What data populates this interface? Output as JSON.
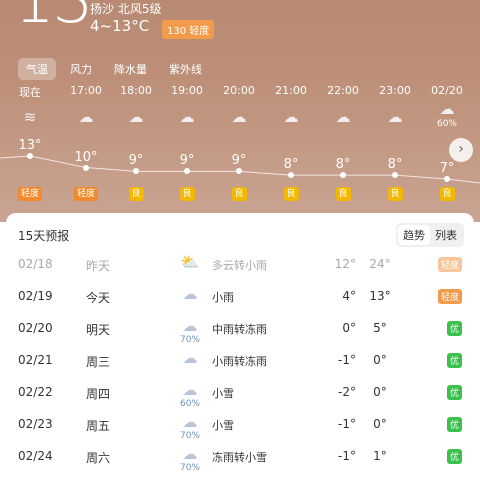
{
  "current": {
    "temp": "13°",
    "location_wind": "扬沙  北风5级",
    "range": "4~13°C",
    "aqi_label": "130 轻度"
  },
  "tabs": [
    {
      "label": "气温",
      "active": true
    },
    {
      "label": "风力",
      "active": false
    },
    {
      "label": "降水量",
      "active": false
    },
    {
      "label": "紫外线",
      "active": false
    }
  ],
  "hourly": [
    {
      "time": "现在",
      "icon": "sand-dust-icon",
      "temp": "13°",
      "aqi": "轻度",
      "aqi_color": "#f08a2c",
      "precip": ""
    },
    {
      "time": "17:00",
      "icon": "cloud-icon",
      "temp": "10°",
      "aqi": "轻度",
      "aqi_color": "#f08a2c",
      "precip": ""
    },
    {
      "time": "18:00",
      "icon": "cloud-icon",
      "temp": "9°",
      "aqi": "良",
      "aqi_color": "#f5b800",
      "precip": ""
    },
    {
      "time": "19:00",
      "icon": "cloud-icon",
      "temp": "9°",
      "aqi": "良",
      "aqi_color": "#f5b800",
      "precip": ""
    },
    {
      "time": "20:00",
      "icon": "cloud-icon",
      "temp": "9°",
      "aqi": "良",
      "aqi_color": "#f5b800",
      "precip": ""
    },
    {
      "time": "21:00",
      "icon": "cloud-icon",
      "temp": "8°",
      "aqi": "良",
      "aqi_color": "#f5b800",
      "precip": ""
    },
    {
      "time": "22:00",
      "icon": "cloud-icon",
      "temp": "8°",
      "aqi": "良",
      "aqi_color": "#f5b800",
      "precip": ""
    },
    {
      "time": "23:00",
      "icon": "cloud-icon",
      "temp": "8°",
      "aqi": "良",
      "aqi_color": "#f5b800",
      "precip": ""
    },
    {
      "time": "02/20",
      "icon": "rain-cloud-icon",
      "temp": "7°",
      "aqi": "良",
      "aqi_color": "#f5b800",
      "precip": "60%"
    }
  ],
  "forecast": {
    "title": "15天预报",
    "view_trend": "趋势",
    "view_list": "列表",
    "days": [
      {
        "date": "02/18",
        "weekday": "昨天",
        "icon": "partly-cloudy-rain-icon",
        "precip": "",
        "condition": "多云转小雨",
        "low": "12°",
        "high": "24°",
        "aqi": "轻度",
        "aqi_color": "#f29b4a",
        "past": true
      },
      {
        "date": "02/19",
        "weekday": "今天",
        "icon": "rain-cloud-icon",
        "precip": "",
        "condition": "小雨",
        "low": "4°",
        "high": "13°",
        "aqi": "轻度",
        "aqi_color": "#f29b4a",
        "past": false
      },
      {
        "date": "02/20",
        "weekday": "明天",
        "icon": "rain-cloud-icon",
        "precip": "70%",
        "condition": "中雨转冻雨",
        "low": "0°",
        "high": "5°",
        "aqi": "优",
        "aqi_color": "#3cc04c",
        "past": false
      },
      {
        "date": "02/21",
        "weekday": "周三",
        "icon": "rain-cloud-icon",
        "precip": "",
        "condition": "小雨转冻雨",
        "low": "-1°",
        "high": "0°",
        "aqi": "优",
        "aqi_color": "#3cc04c",
        "past": false
      },
      {
        "date": "02/22",
        "weekday": "周四",
        "icon": "snow-cloud-icon",
        "precip": "60%",
        "condition": "小雪",
        "low": "-2°",
        "high": "0°",
        "aqi": "优",
        "aqi_color": "#3cc04c",
        "past": false
      },
      {
        "date": "02/23",
        "weekday": "周五",
        "icon": "snow-cloud-icon",
        "precip": "70%",
        "condition": "小雪",
        "low": "-1°",
        "high": "0°",
        "aqi": "优",
        "aqi_color": "#3cc04c",
        "past": false
      },
      {
        "date": "02/24",
        "weekday": "周六",
        "icon": "rain-snow-cloud-icon",
        "precip": "70%",
        "condition": "冻雨转小雪",
        "low": "-1°",
        "high": "1°",
        "aqi": "优",
        "aqi_color": "#3cc04c",
        "past": false
      }
    ]
  }
}
